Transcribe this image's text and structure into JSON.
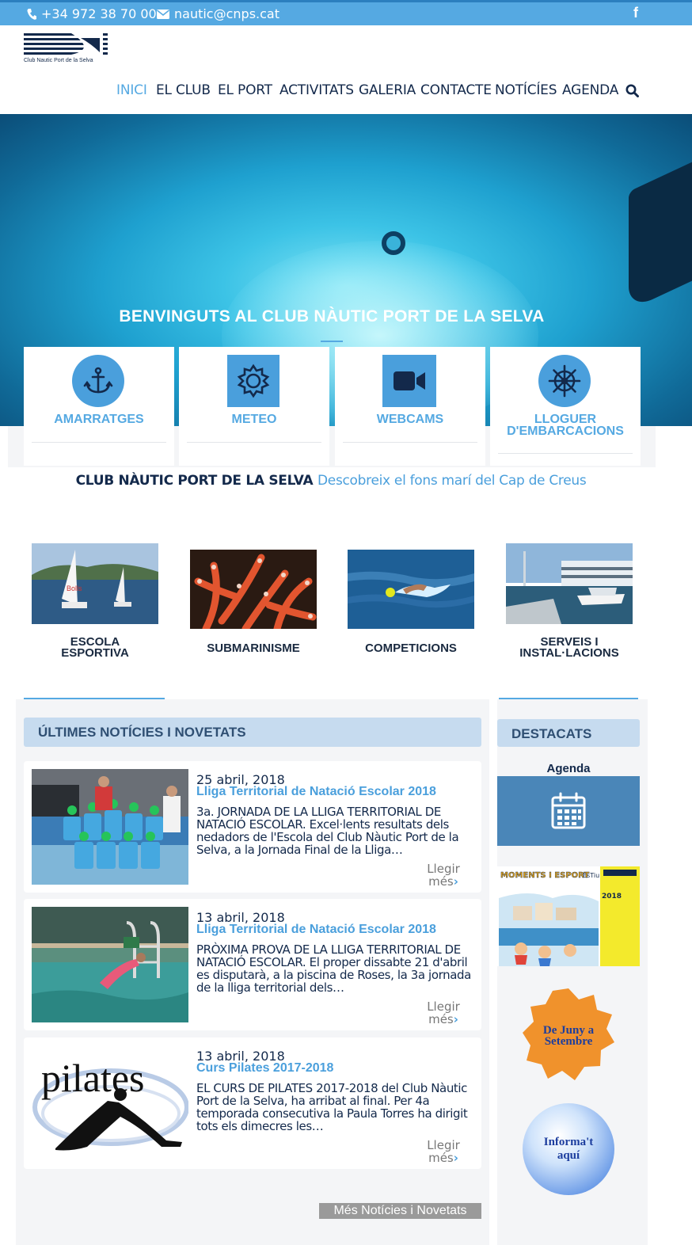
{
  "topbar": {
    "phone": "+34 972 38 70 00",
    "email": "nautic@cnps.cat",
    "social_icon": "facebook-icon",
    "bg_color": "#55a9e2"
  },
  "logo": {
    "caption": "Club Nautic Port de la Selva"
  },
  "nav": {
    "items": [
      "INICI",
      "EL CLUB",
      "EL PORT",
      "ACTIVITATS",
      "GALERIA",
      "CONTACTE",
      "NOTÍCÍES",
      "AGENDA"
    ],
    "active": "INICI",
    "search_icon": "search-icon"
  },
  "hero": {
    "title": "BENVINGUTS AL CLUB NÀUTIC PORT DE LA SELVA"
  },
  "services": [
    {
      "label": "AMARRATGES",
      "icon": "anchor-icon"
    },
    {
      "label": "METEO",
      "icon": "sun-gear-icon"
    },
    {
      "label": "WEBCAMS",
      "icon": "video-camera-icon"
    },
    {
      "label_line1": "LLOGUER",
      "label_line2": "D'EMBARCACIONS",
      "icon": "ship-wheel-icon"
    }
  ],
  "tagline": {
    "strong": "CLUB NÀUTIC PORT DE LA SELVA",
    "light": "Descobreix el fons marí del Cap de Creus"
  },
  "activities": [
    {
      "line1": "ESCOLA",
      "line2": "ESPORTIVA"
    },
    {
      "line1": "SUBMARINISME",
      "line2": ""
    },
    {
      "line1": "COMPETICIONS",
      "line2": ""
    },
    {
      "line1": "SERVEIS I",
      "line2": "INSTAL·LACIONS"
    }
  ],
  "news_section": {
    "heading": "ÚLTIMES NOTÍCIES I NOVETATS",
    "more_button": "Més Notícies i Novetats",
    "read_more_line1": "Llegir",
    "read_more_line2": "més",
    "items": [
      {
        "date": "25 abril, 2018",
        "title": "Lliga Territorial de Natació Escolar 2018",
        "excerpt": "3a. JORNADA DE LA LLIGA TERRITORIAL DE NATACIÓ ESCOLAR.   Excel·lents resultats dels nedadors de l'Escola del Club Nàutic Port de la Selva, a la Jornada Final de la Lliga…"
      },
      {
        "date": "13 abril, 2018",
        "title": "Lliga Territorial de Natació Escolar 2018",
        "excerpt": "PRÒXIMA PROVA DE LA LLIGA TERRITORIAL DE NATACIÓ ESCOLAR.   El proper dissabte 21 d'abril es disputarà, a la piscina de Roses, la 3a jornada de la lliga territorial dels…"
      },
      {
        "date": "13 abril, 2018",
        "title": "Curs Pilates 2017-2018",
        "excerpt": "EL CURS DE PILATES 2017-2018 del Club Nàutic Port de la Selva, ha arribat al final. Per 4a temporada consecutiva la Paula Torres ha dirigit tots els dimecres les…"
      }
    ]
  },
  "sidebar": {
    "heading": "DESTACATS",
    "agenda_label": "Agenda",
    "agenda_icon": "calendar-icon",
    "poster": {
      "title": "MOMENTS I ESPORT",
      "tag": "EsTiu",
      "year": "2018"
    },
    "badge_star": {
      "line1": "De Juny a",
      "line2": "Setembre",
      "color": "#f0922c"
    },
    "badge_round": {
      "line1": "Informa't",
      "line2": "aquí"
    }
  },
  "pilates_logo_text": "pilates"
}
